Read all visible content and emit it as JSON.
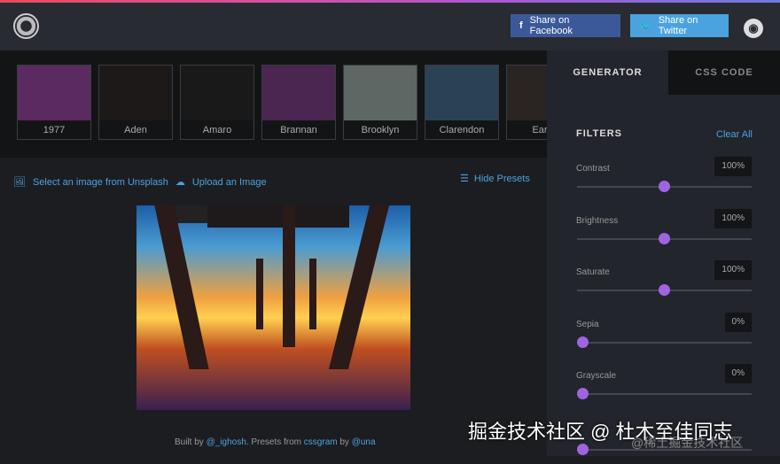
{
  "header": {
    "facebook_label": "Share on Facebook",
    "twitter_label": "Share on Twitter"
  },
  "presets": [
    {
      "label": "1977",
      "color": "#5b2a60"
    },
    {
      "label": "Aden",
      "color": "#1d1918"
    },
    {
      "label": "Amaro",
      "color": "#191919"
    },
    {
      "label": "Brannan",
      "color": "#4a2650"
    },
    {
      "label": "Brooklyn",
      "color": "#5d6764"
    },
    {
      "label": "Clarendon",
      "color": "#2a4256"
    },
    {
      "label": "Early",
      "color": "#2a2422"
    }
  ],
  "actions": {
    "unsplash": "Select an image from Unsplash",
    "upload": "Upload an Image",
    "hide_presets": "Hide Presets"
  },
  "footer": {
    "built_by": "Built by",
    "author": "@_ighosh",
    "presets_from": ". Presets from",
    "cssgram": "cssgram",
    "by": "by",
    "una": "@una"
  },
  "panel": {
    "tab_generator": "GENERATOR",
    "tab_css": "CSS CODE",
    "filters_title": "FILTERS",
    "clear_all": "Clear All",
    "filters": [
      {
        "name": "Contrast",
        "value": "100%",
        "fraction": 0.5
      },
      {
        "name": "Brightness",
        "value": "100%",
        "fraction": 0.5
      },
      {
        "name": "Saturate",
        "value": "100%",
        "fraction": 0.5
      },
      {
        "name": "Sepia",
        "value": "0%",
        "fraction": 0
      },
      {
        "name": "Grayscale",
        "value": "0%",
        "fraction": 0
      }
    ]
  },
  "watermark": {
    "line1": "掘金技术社区 @ 杜木至佳同志",
    "line2": "@稀土掘金技术社区"
  }
}
